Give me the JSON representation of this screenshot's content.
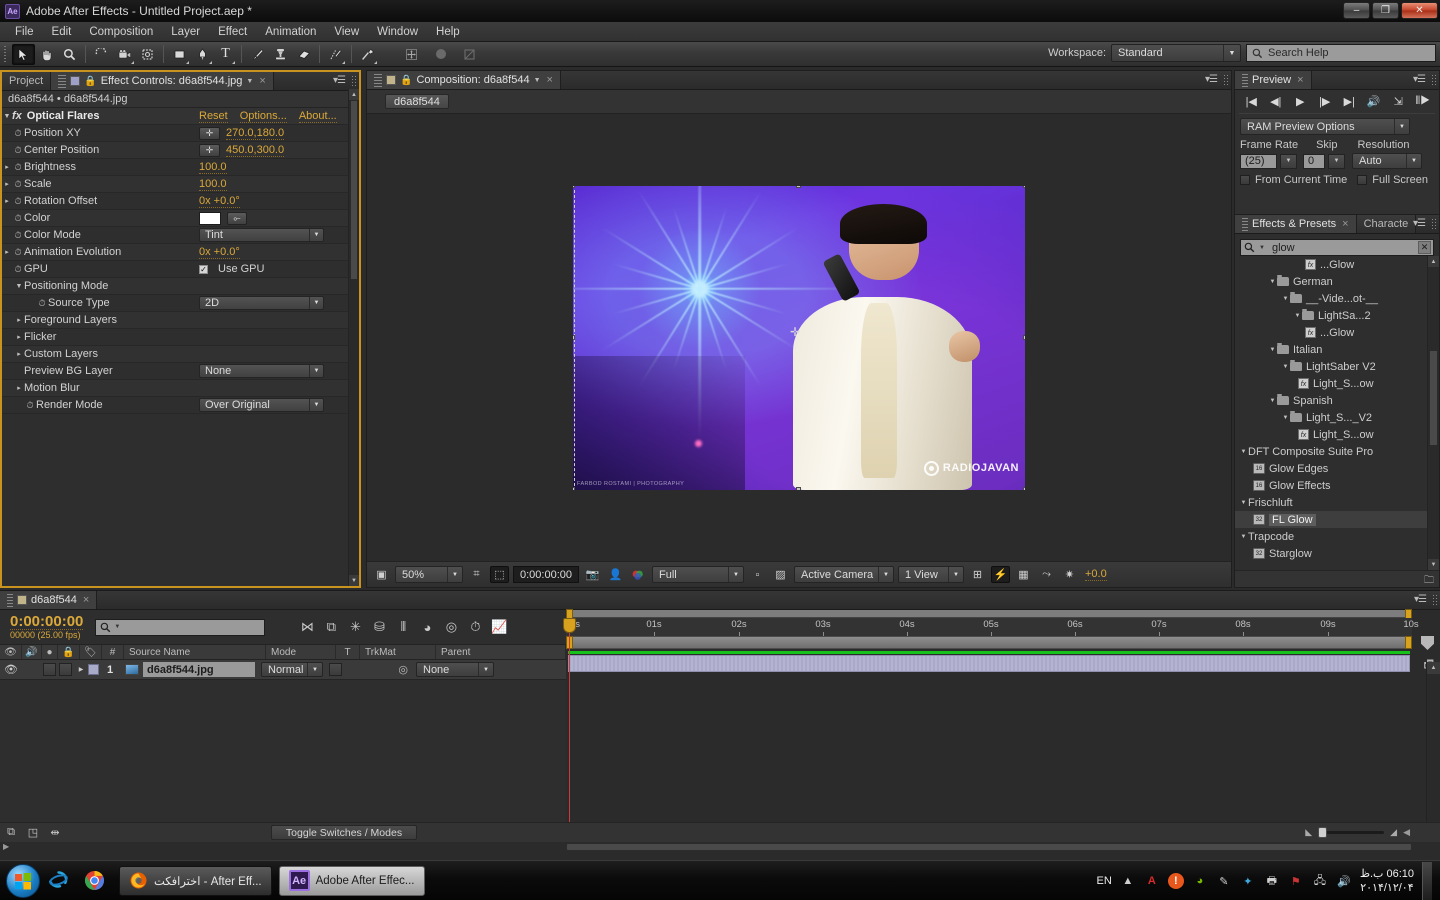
{
  "window": {
    "title": "Adobe After Effects - Untitled Project.aep *",
    "logo": "ae-logo",
    "minimize": "–",
    "maximize": "❐",
    "close": "✕"
  },
  "menu": {
    "items": [
      "File",
      "Edit",
      "Composition",
      "Layer",
      "Effect",
      "Animation",
      "View",
      "Window",
      "Help"
    ]
  },
  "toolbar": {
    "tools": [
      {
        "name": "selection-tool",
        "glyph": "➤",
        "selected": true
      },
      {
        "name": "hand-tool",
        "glyph": "✋",
        "selected": false
      },
      {
        "name": "zoom-tool",
        "glyph": "🔍",
        "selected": false
      },
      {
        "name": "rotation-tool",
        "glyph": "◠",
        "selected": false
      },
      {
        "name": "camera-tool",
        "glyph": "🎥",
        "selected": false
      },
      {
        "name": "pan-behind-tool",
        "glyph": "⬚",
        "selected": false
      },
      {
        "name": "shape-tool",
        "glyph": "▢",
        "selected": false
      },
      {
        "name": "pen-tool",
        "glyph": "✒",
        "selected": false
      },
      {
        "name": "type-tool",
        "glyph": "T",
        "selected": false
      },
      {
        "name": "brush-tool",
        "glyph": "🖌",
        "selected": false
      },
      {
        "name": "clone-stamp-tool",
        "glyph": "⚲",
        "selected": false
      },
      {
        "name": "eraser-tool",
        "glyph": "▱",
        "selected": false
      },
      {
        "name": "roto-brush-tool",
        "glyph": "🖍",
        "selected": false
      },
      {
        "name": "puppet-pin-tool",
        "glyph": "📌",
        "selected": false
      }
    ],
    "workspace_label": "Workspace:",
    "workspace_value": "Standard",
    "search_placeholder": "Search Help"
  },
  "effect_controls": {
    "tab_label": "Effect Controls: d6a8f544.jpg",
    "project_tab": "Project",
    "breadcrumb": "d6a8f544 • d6a8f544.jpg",
    "effect_name": "Optical Flares",
    "links": {
      "reset": "Reset",
      "options": "Options...",
      "about": "About..."
    },
    "properties": [
      {
        "name": "Position XY",
        "value": "270.0,180.0",
        "type": "point",
        "tri": "none"
      },
      {
        "name": "Center Position",
        "value": "450.0,300.0",
        "type": "point",
        "tri": "none"
      },
      {
        "name": "Brightness",
        "value": "100.0",
        "type": "number",
        "tri": "right"
      },
      {
        "name": "Scale",
        "value": "100.0",
        "type": "number",
        "tri": "right"
      },
      {
        "name": "Rotation Offset",
        "value": "0x +0.0°",
        "type": "angle",
        "tri": "right"
      },
      {
        "name": "Color",
        "value": "",
        "type": "color",
        "tri": "none"
      },
      {
        "name": "Color Mode",
        "value": "Tint",
        "type": "dropdown",
        "tri": "none"
      },
      {
        "name": "Animation Evolution",
        "value": "0x +0.0°",
        "type": "angle",
        "tri": "right"
      },
      {
        "name": "GPU",
        "value": "Use GPU",
        "type": "checkbox",
        "tri": "none"
      },
      {
        "name": "Positioning Mode",
        "value": "",
        "type": "group",
        "tri": "down"
      },
      {
        "name": "Source Type",
        "value": "2D",
        "type": "dropdown-indent",
        "tri": "none"
      },
      {
        "name": "Foreground Layers",
        "value": "",
        "type": "group-collapsed",
        "tri": "right"
      },
      {
        "name": "Flicker",
        "value": "",
        "type": "group-collapsed",
        "tri": "right"
      },
      {
        "name": "Custom Layers",
        "value": "",
        "type": "group-collapsed",
        "tri": "right"
      },
      {
        "name": "Preview BG Layer",
        "value": "None",
        "type": "dropdown",
        "tri": "none"
      },
      {
        "name": "Motion Blur",
        "value": "",
        "type": "group-collapsed",
        "tri": "right"
      },
      {
        "name": "Render Mode",
        "value": "Over Original",
        "type": "dropdown",
        "tri": "none"
      }
    ]
  },
  "composition": {
    "tab_label": "Composition: d6a8f544",
    "chip_label": "d6a8f544",
    "image_watermark": "RADIOJAVAN",
    "image_credit": "FARBOD ROSTAMI | PHOTOGRAPHY",
    "bottom_bar": {
      "zoom": "50%",
      "timecode": "0:00:00:00",
      "quality": "Full",
      "camera": "Active Camera",
      "views": "1 View",
      "exposure": "+0.0"
    }
  },
  "preview": {
    "tab_label": "Preview",
    "transport": [
      {
        "name": "first-frame-button",
        "glyph": "|◀"
      },
      {
        "name": "previous-frame-button",
        "glyph": "◀|"
      },
      {
        "name": "play-button",
        "glyph": "▶"
      },
      {
        "name": "next-frame-button",
        "glyph": "|▶"
      },
      {
        "name": "last-frame-button",
        "glyph": "▶|"
      },
      {
        "name": "audio-button",
        "glyph": "🔊"
      },
      {
        "name": "loop-button",
        "glyph": "⇲"
      },
      {
        "name": "ram-preview-button",
        "glyph": "⦀▶"
      }
    ],
    "ram_preview_options": "RAM Preview Options",
    "frame_rate_label": "Frame Rate",
    "frame_rate_value": "(25)",
    "skip_label": "Skip",
    "skip_value": "0",
    "resolution_label": "Resolution",
    "resolution_value": "Auto",
    "from_current_time": "From Current Time",
    "full_screen": "Full Screen"
  },
  "effects_presets": {
    "tab_label": "Effects & Presets",
    "tab_secondary": "Characte",
    "search_value": "glow",
    "items": [
      {
        "label": "...Glow",
        "type": "preset",
        "indent": 6
      },
      {
        "label": "German",
        "type": "folder",
        "indent": 3
      },
      {
        "label": "__-Vide...ot-__",
        "type": "folder",
        "indent": 4
      },
      {
        "label": "LightSa...2",
        "type": "folder",
        "indent": 5
      },
      {
        "label": "...Glow",
        "type": "preset",
        "indent": 6
      },
      {
        "label": "Italian",
        "type": "folder",
        "indent": 3
      },
      {
        "label": "LightSaber V2",
        "type": "folder",
        "indent": 4
      },
      {
        "label": "Light_S...ow",
        "type": "preset",
        "indent": 5
      },
      {
        "label": "Spanish",
        "type": "folder",
        "indent": 3
      },
      {
        "label": "Light_S..._V2",
        "type": "folder",
        "indent": 4
      },
      {
        "label": "Light_S...ow",
        "type": "preset",
        "indent": 5
      },
      {
        "label": "DFT Composite Suite Pro",
        "type": "category",
        "indent": 0
      },
      {
        "label": "Glow Edges",
        "type": "effect16",
        "indent": 1
      },
      {
        "label": "Glow Effects",
        "type": "effect16",
        "indent": 1
      },
      {
        "label": "Frischluft",
        "type": "category",
        "indent": 0
      },
      {
        "label": "FL Glow",
        "type": "effect32",
        "indent": 1,
        "highlighted": true
      },
      {
        "label": "Trapcode",
        "type": "category",
        "indent": 0
      },
      {
        "label": "Starglow",
        "type": "effect32",
        "indent": 1
      }
    ]
  },
  "timeline": {
    "tab_label": "d6a8f544",
    "current_time": "0:00:00:00",
    "frame_info": "00000 (25.00 fps)",
    "search_placeholder": "",
    "columns": [
      "#",
      "Source Name",
      "Mode",
      "T",
      "TrkMat",
      "Parent"
    ],
    "layers": [
      {
        "index": "1",
        "source_name": "d6a8f544.jpg",
        "mode": "Normal",
        "trkmat": "",
        "parent": "None"
      }
    ],
    "ruler_labels": [
      "0s",
      "01s",
      "02s",
      "03s",
      "04s",
      "05s",
      "06s",
      "07s",
      "08s",
      "09s",
      "10s"
    ],
    "toggle_button": "Toggle Switches / Modes"
  },
  "taskbar": {
    "start": "start-orb",
    "quicklaunch": [
      {
        "name": "internet-explorer-icon",
        "glyph": "e"
      },
      {
        "name": "google-chrome-icon",
        "glyph": "◉"
      }
    ],
    "tasks": [
      {
        "name": "firefox-task",
        "label": "اخترافكت - After Eff...",
        "icon": "firefox-icon",
        "active": false
      },
      {
        "name": "after-effects-task",
        "label": "Adobe After Effec...",
        "icon": "ae-icon",
        "active": true
      }
    ],
    "language": "EN",
    "tray_icons": [
      {
        "name": "show-hidden-icons",
        "glyph": "▲"
      },
      {
        "name": "acrobat-icon",
        "glyph": "A"
      },
      {
        "name": "alert-icon",
        "glyph": "!"
      },
      {
        "name": "nvidia-icon",
        "glyph": "◕"
      },
      {
        "name": "pen-icon",
        "glyph": "✎"
      },
      {
        "name": "nod32-icon",
        "glyph": "✦"
      },
      {
        "name": "printer-icon",
        "glyph": "🖶"
      },
      {
        "name": "flag-icon",
        "glyph": "⚑"
      },
      {
        "name": "network-icon",
        "glyph": "🖧"
      },
      {
        "name": "volume-icon",
        "glyph": "🔊"
      }
    ],
    "time": "06:10 ب.ظ",
    "date": "۲۰۱۴/۱۲/۰۴"
  },
  "colors": {
    "accent_orange": "#dba93a",
    "panel_bg": "#2e2e2e",
    "highlight_border": "#c8931e",
    "green_bar": "#16c21a",
    "cti_red": "#cc3b3b"
  }
}
